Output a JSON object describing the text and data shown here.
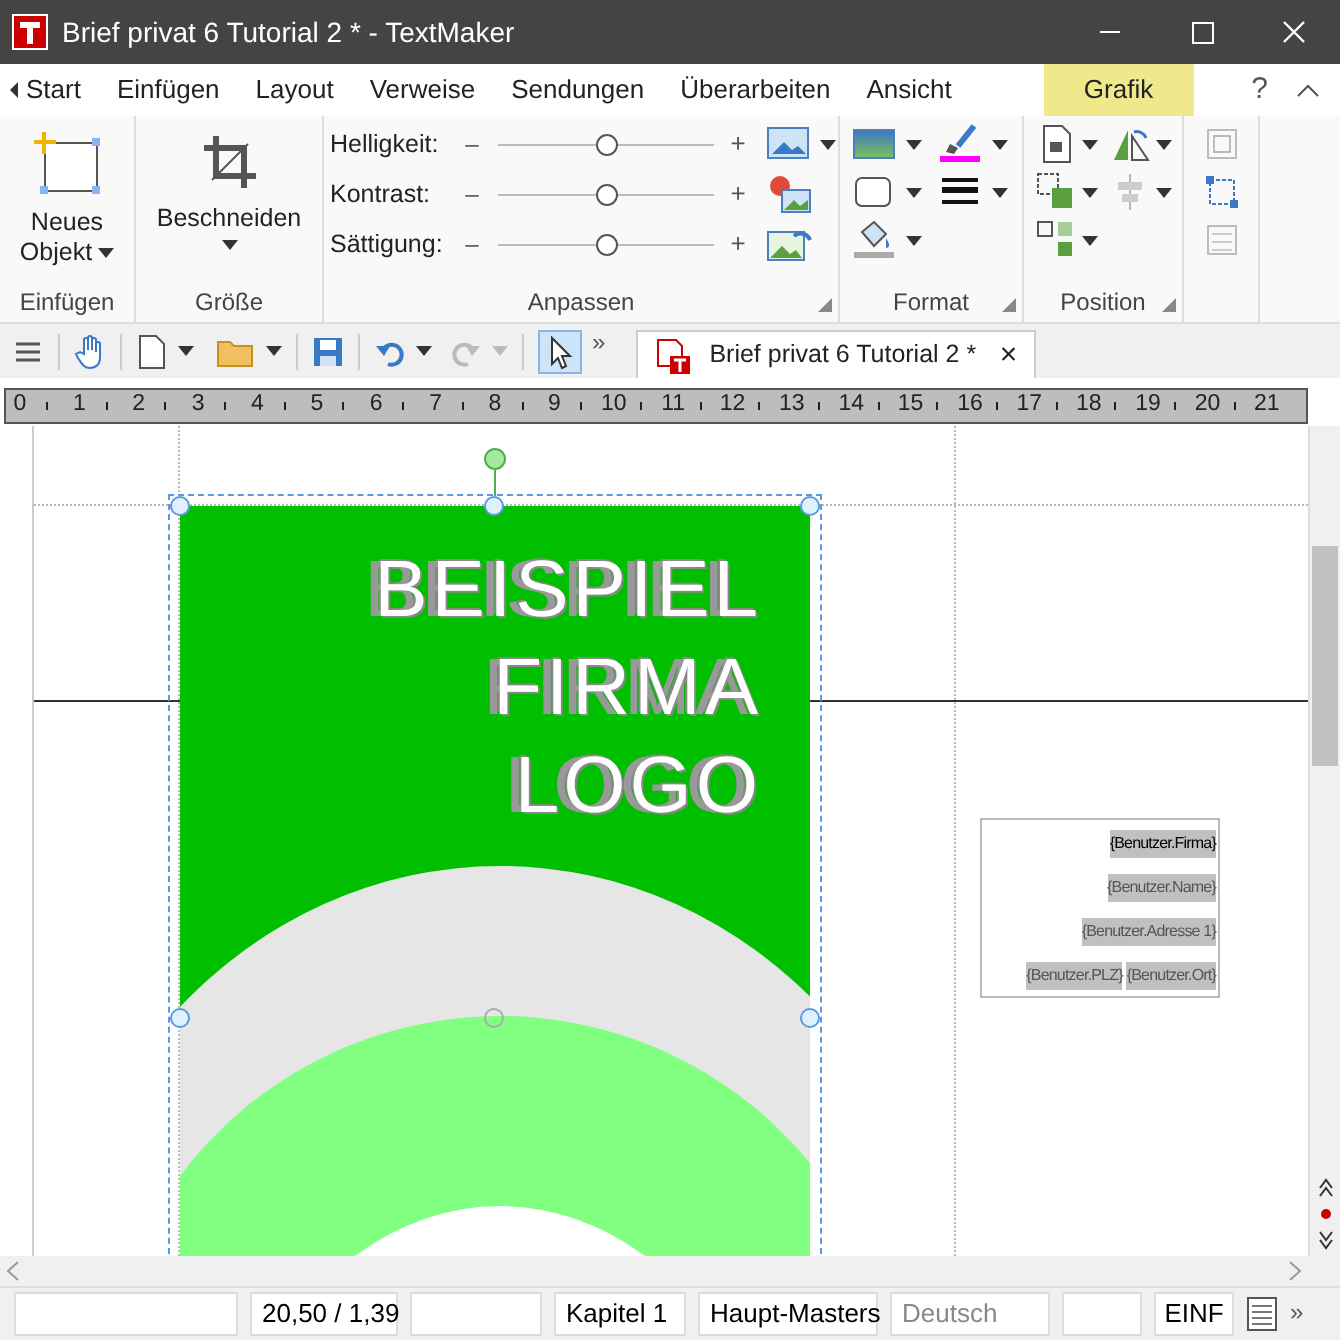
{
  "window": {
    "title": "Brief privat 6 Tutorial 2 * - TextMaker"
  },
  "tabs": [
    {
      "label": "Start",
      "selected": false
    },
    {
      "label": "Einfügen",
      "selected": false
    },
    {
      "label": "Layout",
      "selected": false
    },
    {
      "label": "Verweise",
      "selected": false
    },
    {
      "label": "Sendungen",
      "selected": false
    },
    {
      "label": "Überarbeiten",
      "selected": false
    },
    {
      "label": "Ansicht",
      "selected": false
    },
    {
      "label": "Grafik",
      "selected": true
    }
  ],
  "help": "?",
  "ribbon": {
    "new_object": "Neues Objekt",
    "crop": "Beschneiden",
    "sliders": [
      {
        "label": "Helligkeit:",
        "minus": "–",
        "plus": "+",
        "level": 0.5
      },
      {
        "label": "Kontrast:",
        "minus": "–",
        "plus": "+",
        "level": 0.5
      },
      {
        "label": "Sättigung:",
        "minus": "–",
        "plus": "+",
        "level": 0.5
      }
    ],
    "groups": [
      "Einfügen",
      "Größe",
      "Anpassen",
      "Format",
      "Position"
    ]
  },
  "toolbar": {
    "more": "»",
    "document_tab": "Brief privat 6 Tutorial 2 *",
    "close": "×"
  },
  "ruler": [
    "0",
    "1",
    "2",
    "3",
    "4",
    "5",
    "6",
    "7",
    "8",
    "9",
    "10",
    "11",
    "12",
    "13",
    "14",
    "15",
    "16",
    "17",
    "18",
    "19",
    "20",
    "21"
  ],
  "logo": {
    "lines": [
      "BEISPIEL",
      "FIRMA",
      "LOGO"
    ]
  },
  "address_fields": [
    [
      "{Benutzer.Firma}"
    ],
    [
      "{Benutzer.Name}"
    ],
    [
      "{Benutzer.Adresse 1}"
    ],
    [
      "{Benutzer.PLZ}",
      "{Benutzer.Ort}"
    ]
  ],
  "status_bar": [
    {
      "kind": "empty"
    },
    {
      "kind": "text",
      "text": "20,50 / 1,39",
      "disabled": false
    },
    {
      "kind": "empty"
    },
    {
      "kind": "text",
      "text": "Kapitel 1",
      "disabled": false
    },
    {
      "kind": "text",
      "text": "Haupt-Masters",
      "disabled": false
    },
    {
      "kind": "text",
      "text": "Deutsch",
      "disabled": true
    },
    {
      "kind": "empty"
    },
    {
      "kind": "text",
      "text": "EINF",
      "disabled": false
    }
  ],
  "status_more": "»"
}
